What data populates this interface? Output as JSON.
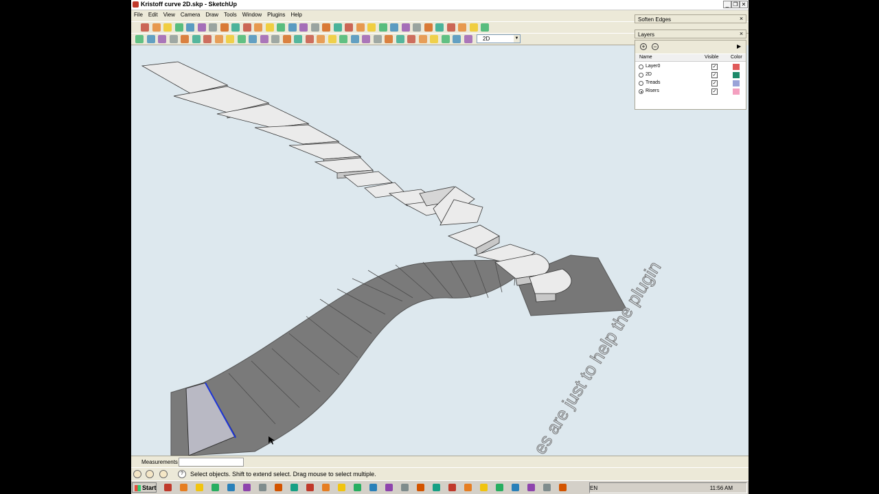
{
  "window": {
    "title": "Kristoff curve 2D.skp - SketchUp",
    "controls": [
      "_",
      "❐",
      "✕"
    ]
  },
  "menu": [
    "File",
    "Edit",
    "View",
    "Camera",
    "Draw",
    "Tools",
    "Window",
    "Plugins",
    "Help"
  ],
  "toolbar": {
    "layer_select_value": "2D",
    "row1_icons": [
      "select-icon",
      "pencil-icon",
      "rectangle-icon",
      "box-icon",
      "circle-icon",
      "arc-icon",
      "eraser-icon",
      "paint-bucket-icon",
      "push-pull-icon",
      "tape-icon",
      "move-icon",
      "rotate-icon",
      "rotate2-icon",
      "section-icon",
      "orbit-icon",
      "pan-icon",
      "zoom-icon",
      "zoom-extents-icon",
      "iso-view-icon",
      "top-view-icon",
      "front-view-icon",
      "right-view-icon",
      "component-icon",
      "group-icon",
      "layer-icon",
      "text-icon",
      "dimension-icon",
      "2d-icon",
      "shadow-icon",
      "fog-icon",
      "style-icon"
    ],
    "row2_icons": [
      "plugin-icon"
    ]
  },
  "viewport": {
    "watermark_text": "es are just to help the plugin"
  },
  "measurements": {
    "label": "Measurements",
    "value": ""
  },
  "status": {
    "hint": "Select objects. Shift to extend select. Drag mouse to select multiple."
  },
  "soften_edges": {
    "title": "Soften Edges"
  },
  "layers_panel": {
    "title": "Layers",
    "col_name": "Name",
    "col_visible": "Visible",
    "col_color": "Color",
    "rows": [
      {
        "name": "Layer0",
        "active": false,
        "visible": true,
        "color": "#e05a5a"
      },
      {
        "name": "2D",
        "active": false,
        "visible": true,
        "color": "#1e8a6a"
      },
      {
        "name": "Treads",
        "active": false,
        "visible": true,
        "color": "#9aa3d8"
      },
      {
        "name": "Risers",
        "active": true,
        "visible": true,
        "color": "#f4a0c0"
      }
    ]
  },
  "taskbar": {
    "start_label": "Start",
    "language": "EN",
    "clock": "11:56 AM"
  }
}
